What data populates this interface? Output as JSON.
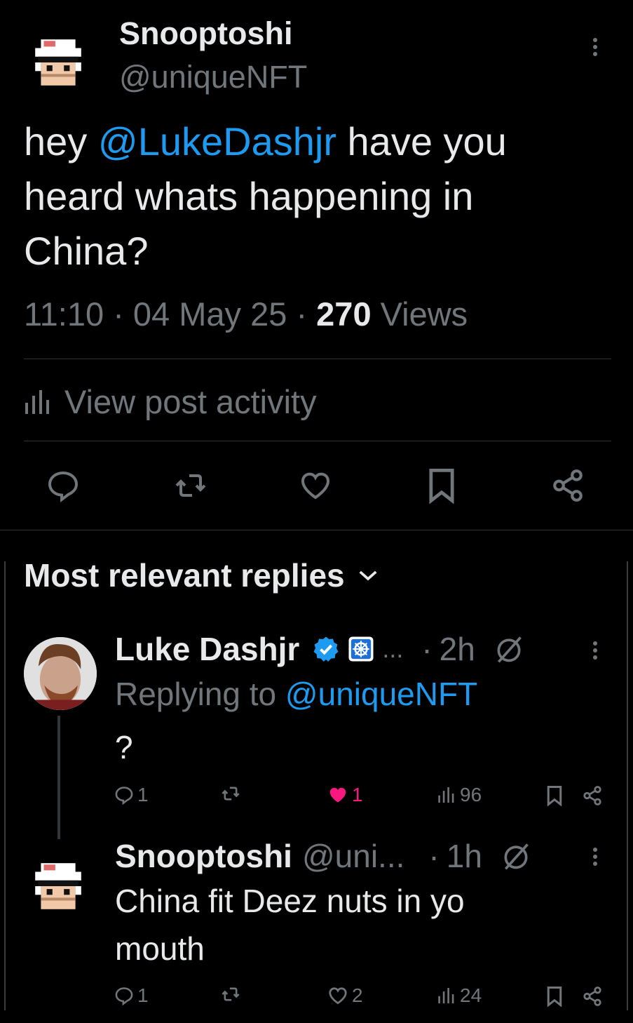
{
  "post": {
    "author_name": "Snooptoshi",
    "author_handle": "@uniqueNFT",
    "text_before": "hey ",
    "mention": "@LukeDashjr",
    "text_after": " have you heard whats happening in China?",
    "time": "11:10",
    "date": "04 May 25",
    "views_count": "270",
    "views_label": "Views",
    "separator": "·",
    "activity_label": "View post activity"
  },
  "replies_header": {
    "label": "Most relevant replies"
  },
  "replies": [
    {
      "author_name": "Luke Dashjr",
      "ellipsis": "...",
      "time": "2h",
      "replying_label": "Replying to",
      "replying_handle": "@uniqueNFT",
      "text": "?",
      "stats": {
        "replies": "1",
        "likes": "1",
        "views": "96"
      },
      "liked": true
    },
    {
      "author_name": "Snooptoshi",
      "author_handle": "@uni...",
      "time": "1h",
      "text": "China fit Deez nuts in yo mouth",
      "stats": {
        "replies": "1",
        "likes": "2",
        "views": "24"
      },
      "liked": false
    }
  ],
  "colors": {
    "background": "#000000",
    "text": "#e7e9ea",
    "muted": "#71767b",
    "link": "#1d9bf0",
    "like": "#f91880",
    "divider": "#2f3336"
  }
}
